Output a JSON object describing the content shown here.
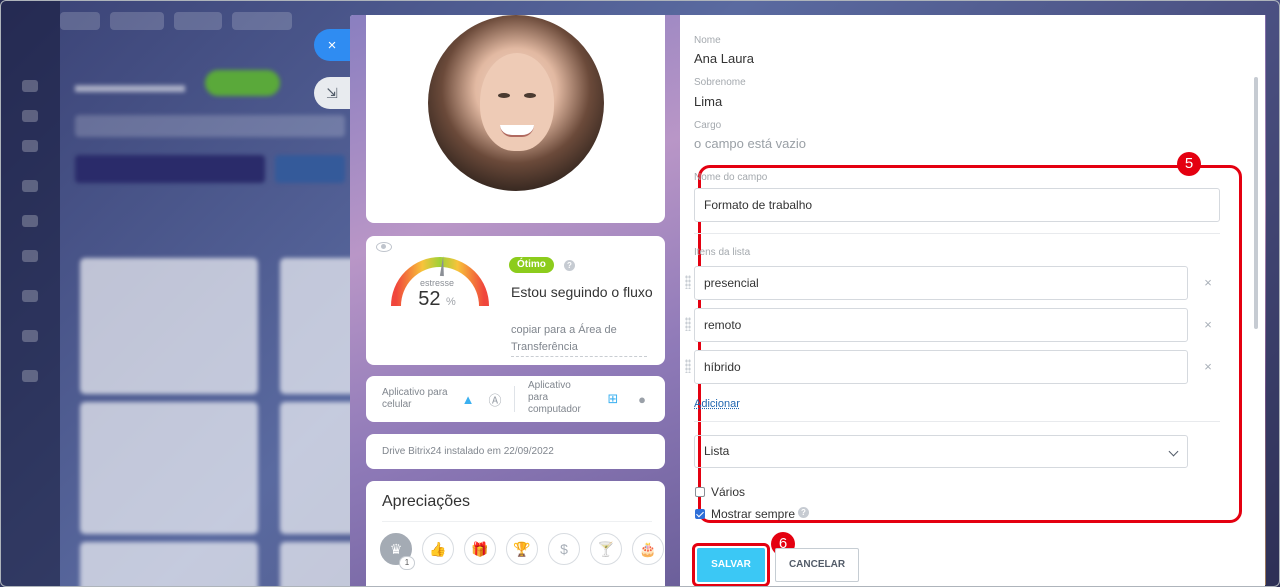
{
  "colors": {
    "accent": "#3bc8f5",
    "highlight": "#e40010",
    "status_green": "#8ccc1c",
    "link": "#2066b0"
  },
  "side_buttons": {
    "close_icon": "×",
    "collapse_icon": "⇲"
  },
  "profile": {
    "stress": {
      "label": "estresse",
      "value": "52",
      "unit": "%",
      "level_fraction": 0.52,
      "status": "Ótimo",
      "message": "Estou seguindo o fluxo",
      "copy_link": "copiar para a Área de Transferência"
    },
    "apps": {
      "mobile_label": "Aplicativo para celular",
      "desktop_label": "Aplicativo para computador"
    },
    "drive": "Drive Bitrix24 instalado em 22/09/2022",
    "appreciations": {
      "title": "Apreciações",
      "icons": [
        {
          "name": "crown-icon",
          "glyph": "♛",
          "count": "1"
        },
        {
          "name": "thumbs-up-icon",
          "glyph": "👍"
        },
        {
          "name": "gift-icon",
          "glyph": "🎁"
        },
        {
          "name": "trophy-icon",
          "glyph": "🏆"
        },
        {
          "name": "money-bag-icon",
          "glyph": "$"
        },
        {
          "name": "cocktail-icon",
          "glyph": "🍸"
        },
        {
          "name": "cake-icon",
          "glyph": "🎂"
        }
      ]
    }
  },
  "fields": {
    "first_name": {
      "label": "Nome",
      "value": "Ana Laura"
    },
    "last_name": {
      "label": "Sobrenome",
      "value": "Lima"
    },
    "position": {
      "label": "Cargo",
      "value": "o campo está vazio"
    }
  },
  "editor": {
    "field_name_label": "Nome do campo",
    "field_name_value": "Formato de trabalho",
    "list_items_label": "Itens da lista",
    "list_items": [
      "presencial",
      "remoto",
      "híbrido"
    ],
    "add_label": "Adicionar",
    "type_value": "Lista",
    "multiple_label": "Vários",
    "multiple_checked": false,
    "always_show_label": "Mostrar sempre",
    "always_show_checked": true
  },
  "buttons": {
    "save": "SALVAR",
    "cancel": "CANCELAR"
  },
  "markers": {
    "edit_area": "5",
    "save": "6"
  }
}
